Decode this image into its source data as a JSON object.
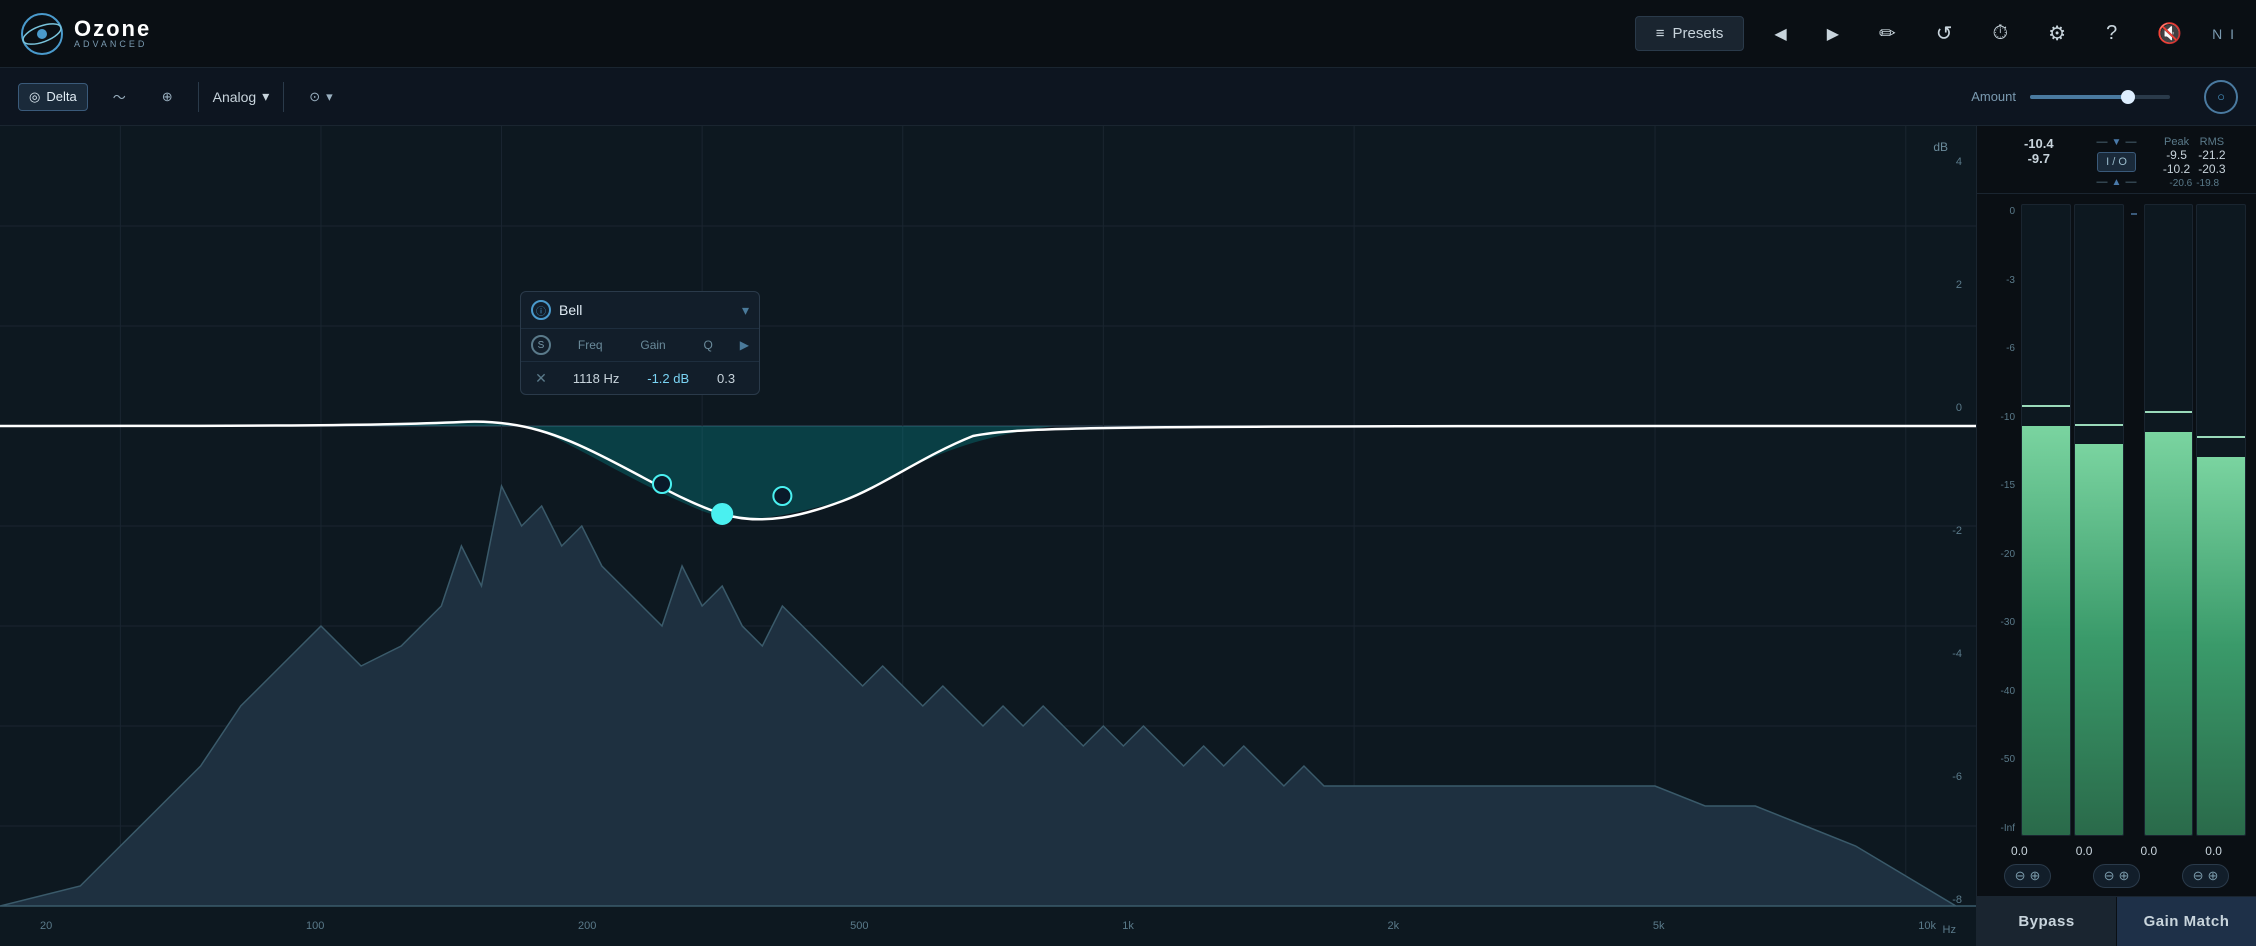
{
  "app": {
    "title": "Ozone",
    "subtitle": "ADVANCED",
    "logo_symbol": "◎"
  },
  "topnav": {
    "presets_label": "Presets",
    "prev_arrow": "◀",
    "next_arrow": "▶",
    "pencil_icon": "✏",
    "undo_icon": "↺",
    "history_icon": "⏱",
    "settings_icon": "⚙",
    "help_icon": "?",
    "speaker_icon": "🔊",
    "ni_icon": "N I"
  },
  "toolbar": {
    "delta_label": "Delta",
    "curve_icon": "〜",
    "globe_icon": "⊕",
    "analog_label": "Analog",
    "dropdown_icon": "▾",
    "io_icon": "⊙",
    "io_dropdown": "▾",
    "amount_label": "Amount",
    "amount_value": 70,
    "output_btn": "○"
  },
  "eq_panel": {
    "db_label": "dB",
    "db_scale": [
      "4",
      "2",
      "0",
      "-2",
      "-4",
      "-6",
      "-8"
    ],
    "freq_labels": [
      "20",
      "100",
      "200",
      "500",
      "1k",
      "2k",
      "5k",
      "10k"
    ],
    "freq_hz": "Hz",
    "popup": {
      "band_icon": "ⓘ",
      "band_type": "Bell",
      "dropdown_icon": "▾",
      "s_icon": "S",
      "freq_header": "Freq",
      "gain_header": "Gain",
      "q_header": "Q",
      "expand_icon": "▶",
      "freq_value": "1118 Hz",
      "gain_value": "-1.2 dB",
      "q_value": "0.3"
    }
  },
  "meters": {
    "left_peak": "-10.4",
    "left_rms": "-20.6",
    "left_rms2": "-19.8",
    "right_peak": "-9.7",
    "io_label": "I / O",
    "right_section_peak": "-9.5",
    "right_section_peak2": "-10.2",
    "right_section_rms": "-21.2",
    "right_section_rms2": "-20.3",
    "peak_label": "Peak",
    "rms_label": "RMS",
    "scale_labels": [
      "0",
      "-3",
      "-6",
      "-10",
      "-15",
      "-20",
      "-30",
      "-40",
      "-50",
      "-Inf"
    ],
    "bottom_values": [
      "0.0",
      "0.0",
      "0.0",
      "0.0"
    ],
    "ctrl_btns": [
      {
        "label": "⊖⊕",
        "id": "link1"
      },
      {
        "label": "⊖⊕",
        "id": "link2"
      },
      {
        "label": "⊖⊕",
        "id": "link3"
      }
    ]
  },
  "action_buttons": {
    "bypass_label": "Bypass",
    "gain_match_label": "Gain Match"
  }
}
